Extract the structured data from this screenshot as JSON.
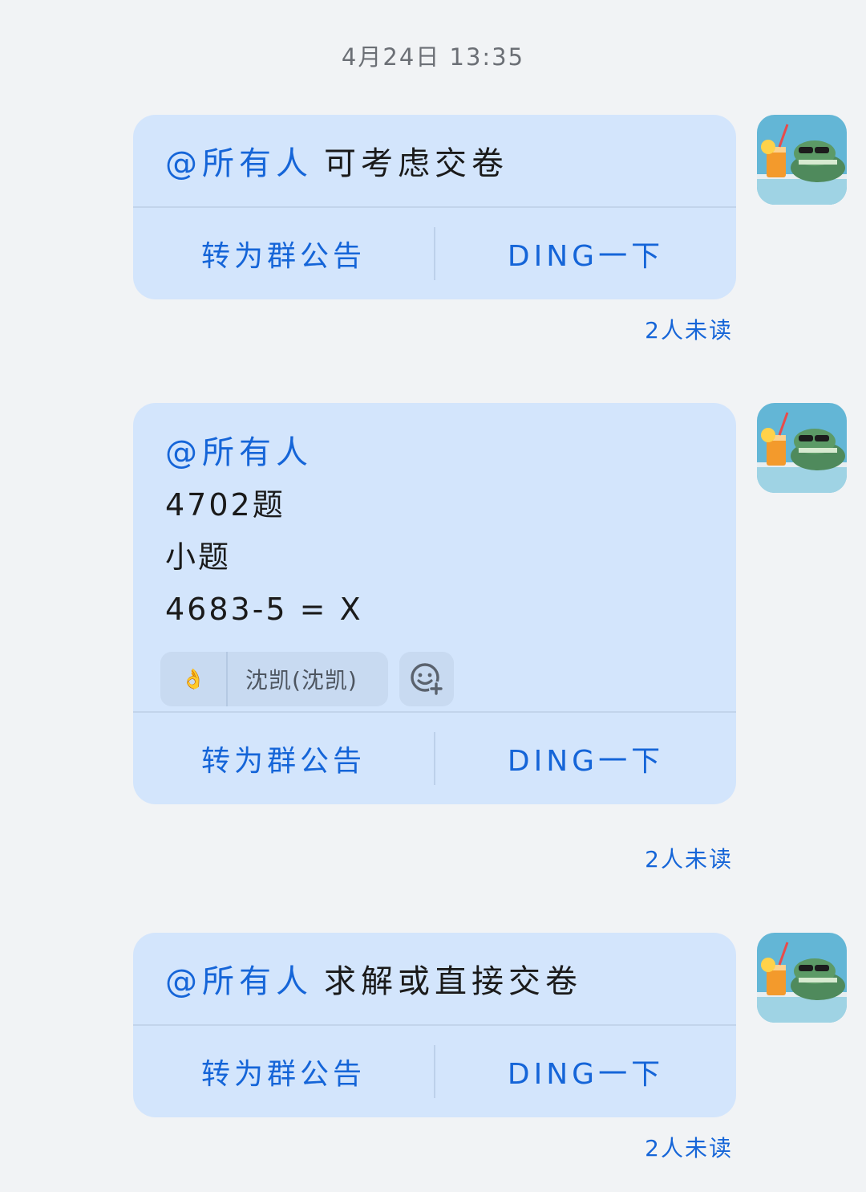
{
  "timestamp": "4月24日 13:35",
  "messages": [
    {
      "mention": "@所有人",
      "text": "可考虑交卷",
      "actions": {
        "announce": "转为群公告",
        "ding": "DING一下"
      },
      "unread": "2人未读"
    },
    {
      "mention": "@所有人",
      "lines": [
        "4702题",
        "小题",
        "4683-5 = X"
      ],
      "reaction": {
        "emoji": "👌",
        "user": "沈凯(沈凯)"
      },
      "add_reaction_icon": "add-emoji-icon",
      "actions": {
        "announce": "转为群公告",
        "ding": "DING一下"
      },
      "unread": "2人未读"
    },
    {
      "mention": "@所有人",
      "text": "求解或直接交卷",
      "actions": {
        "announce": "转为群公告",
        "ding": "DING一下"
      },
      "unread": "2人未读"
    }
  ],
  "colors": {
    "background": "#f1f3f5",
    "bubble": "#d3e5fc",
    "accent": "#1565d8"
  }
}
